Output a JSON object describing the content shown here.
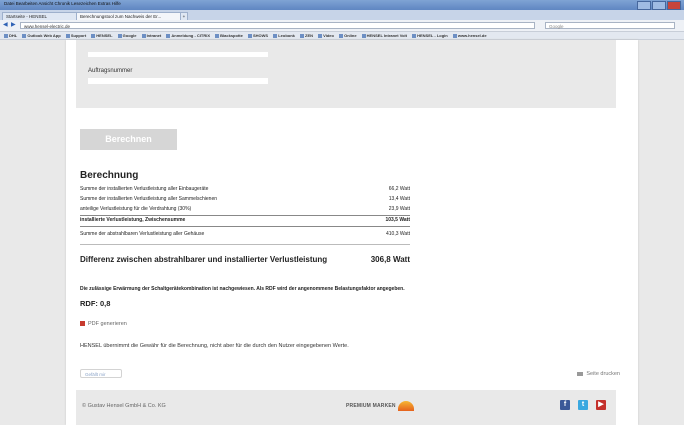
{
  "browser": {
    "menu": "Datei  Bearbeiten  Ansicht  Chronik  Lesezeichen  Extras  Hilfe",
    "tabs": [
      "Startseite - HENSEL",
      "Berechnungstool zum Nachweis der Er..."
    ],
    "url": "www.hensel-electric.de",
    "search_placeholder": "Google",
    "bookmarks": [
      "DHL",
      "Outlook Web App",
      "Support",
      "HENSEL",
      "Google",
      "Intranet",
      "Anmeldung - CITRIX",
      "Blackspotte",
      "SHOWS",
      "Leobonk",
      "ZEN",
      "Video",
      "Online",
      "HENSEL Intranet Volt",
      "HENSEL - Login",
      "www.hensel.de"
    ]
  },
  "form": {
    "order_label": "Auftragsnummer",
    "calculate_label": "Berechnen"
  },
  "result": {
    "title": "Berechnung",
    "rows": [
      {
        "label": "Summe der installierten Verlustleistung aller Einbaugeräte",
        "value": "66,2 Watt"
      },
      {
        "label": "Summe der installierten Verlustleistung aller Sammelschienen",
        "value": "13,4 Watt"
      },
      {
        "label": "anteilige Verlustleistung für die Verdrahtung (30%)",
        "value": "23,9 Watt"
      },
      {
        "label": "installierte Verlustleistung, Zwischensumme",
        "value": "103,5 Watt"
      },
      {
        "label": "Summe der abstrahlbaren Verlustleistung aller Gehäuse",
        "value": "410,3 Watt"
      }
    ],
    "difference_label": "Differenz zwischen abstrahlbarer und installierter Verlustleistung",
    "difference_value": "306,8 Watt",
    "proof_note": "Die zulässige Erwärmung der Schaltgerätekombination ist nachgewiesen. Als RDF wird der angenommene Belastungsfaktor angegeben.",
    "rdf": "RDF: 0,8",
    "pdf_label": "PDF generieren",
    "disclaimer": "HENSEL übernimmt die Gewähr für die Berechnung, nicht aber für die durch den Nutzer eingegebenen Werte."
  },
  "actions": {
    "like_label": "Gefällt mir",
    "print_label": "Seite drucken"
  },
  "footer": {
    "copyright": "© Gustav Hensel GmbH & Co. KG",
    "brand": "PREMIUM MARKEN"
  }
}
